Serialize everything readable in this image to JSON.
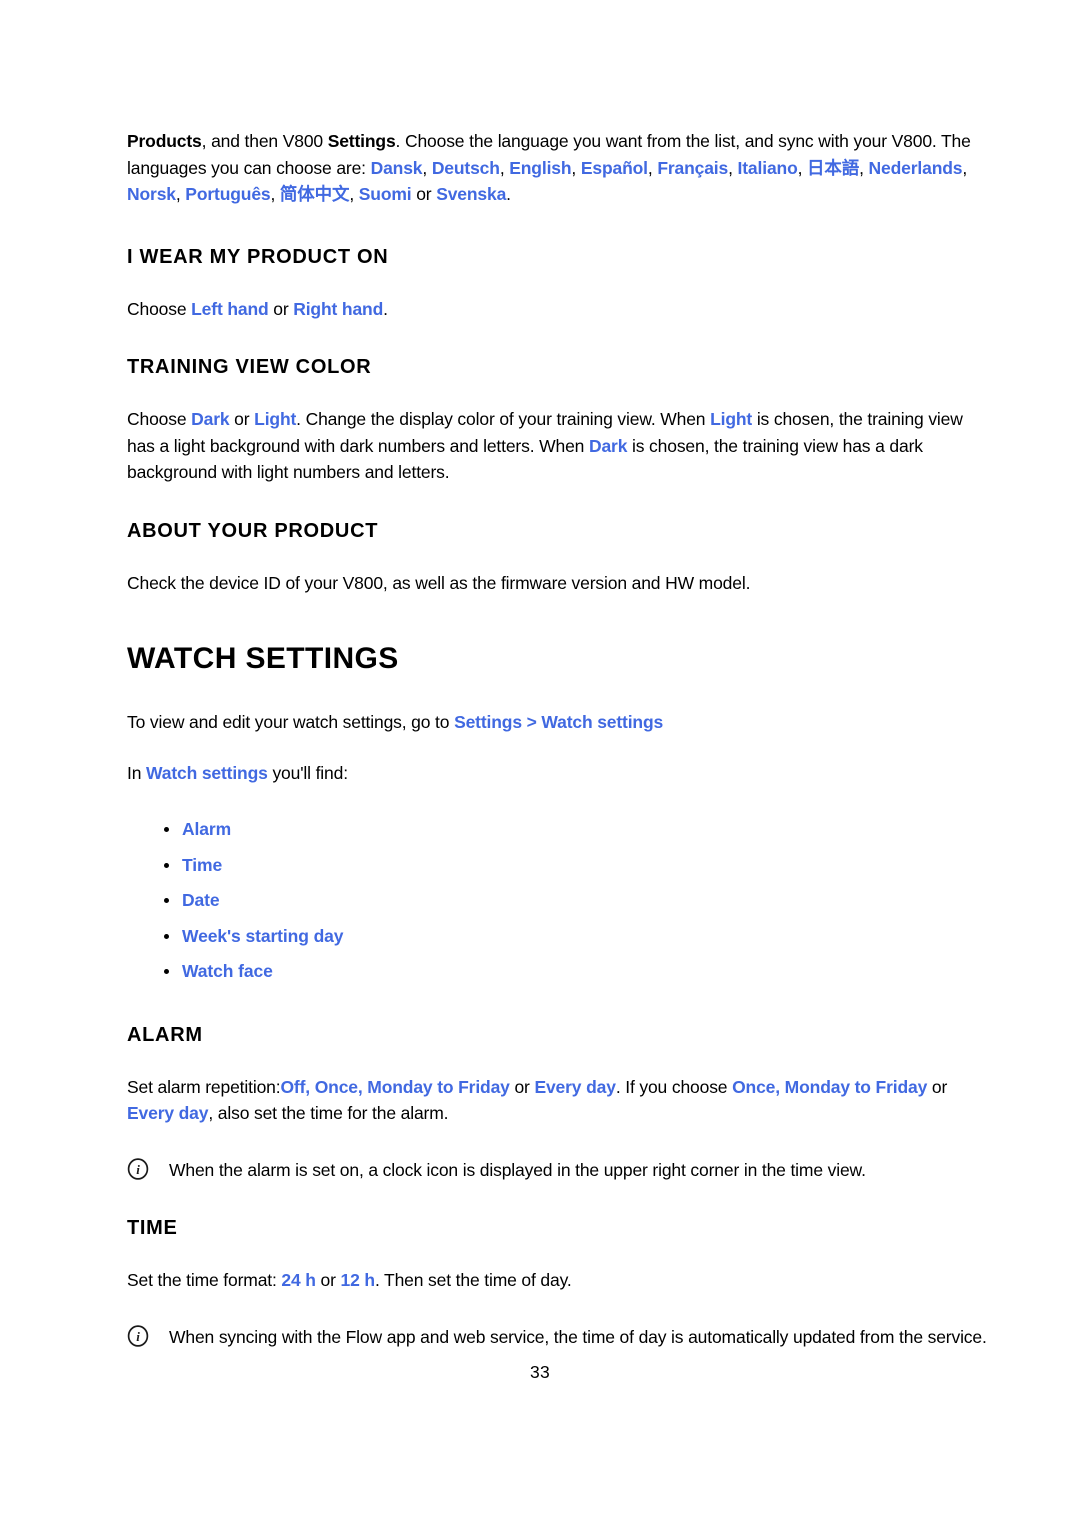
{
  "document": {
    "page_number": "33",
    "link_color": "#4169e1",
    "text_color": "#000000",
    "background_color": "#ffffff"
  },
  "intro": {
    "seg1_bold": "Products",
    "seg2": ", and then V800 ",
    "seg3_bold": "Settings",
    "seg4": ". Choose the language you want from the list, and sync with your V800. The languages you can choose are: ",
    "languages": [
      "Dansk",
      "Deutsch",
      "English",
      "Español",
      "Français",
      "Italiano",
      "日本語",
      "Nederlands",
      "Norsk",
      "Português",
      "简体中文",
      "Suomi",
      "Svenska"
    ],
    "separator": ", ",
    "or_word": " or ",
    "period": "."
  },
  "sections": {
    "wear": {
      "heading": "I WEAR MY PRODUCT ON",
      "body_pre": "Choose ",
      "option1": "Left hand",
      "body_mid": " or ",
      "option2": "Right hand",
      "body_post": "."
    },
    "training_view_color": {
      "heading": "TRAINING VIEW COLOR",
      "p1": "Choose ",
      "opt_dark_1": "Dark",
      "p2": " or ",
      "opt_light_1": "Light",
      "p3": ". Change the display color of your training view. When ",
      "opt_light_2": "Light",
      "p4": " is chosen, the training view has a light background with dark numbers and letters. When ",
      "opt_dark_2": "Dark",
      "p5": " is chosen, the training view has a dark background with light numbers and letters."
    },
    "about_product": {
      "heading": "ABOUT YOUR PRODUCT",
      "body": "Check the device ID of your V800, as well as the firmware version and HW model."
    }
  },
  "chapter": {
    "title": "WATCH SETTINGS",
    "intro_pre": "To view and edit your watch settings, go to ",
    "intro_link": "Settings > Watch settings",
    "find_pre": "In ",
    "find_link": "Watch settings",
    "find_post": " you'll find:",
    "items": [
      {
        "label": "Alarm"
      },
      {
        "label": "Time"
      },
      {
        "label": "Date"
      },
      {
        "label": "Week's starting day"
      },
      {
        "label": "Watch face"
      }
    ]
  },
  "alarm": {
    "heading": "ALARM",
    "p1": "Set alarm repetition:",
    "options1": "Off, Once, Monday to Friday",
    "p2": " or ",
    "options2": "Every day",
    "p3": ". If you choose ",
    "options3": "Once, Monday to Friday",
    "p4": " or ",
    "options4": "Every day",
    "p5": ", also set the time for the alarm.",
    "note": "When the alarm is set on, a clock icon is displayed in the upper right corner in the time view.",
    "note_icon": "info-icon"
  },
  "time": {
    "heading": "TIME",
    "p1": "Set the time format: ",
    "format1": "24 h",
    "p2": " or ",
    "format2": "12 h",
    "p3": ". Then set the time of day.",
    "note": "When syncing with the Flow app and web service, the time of day is automatically updated from the service.",
    "note_icon": "info-icon"
  }
}
